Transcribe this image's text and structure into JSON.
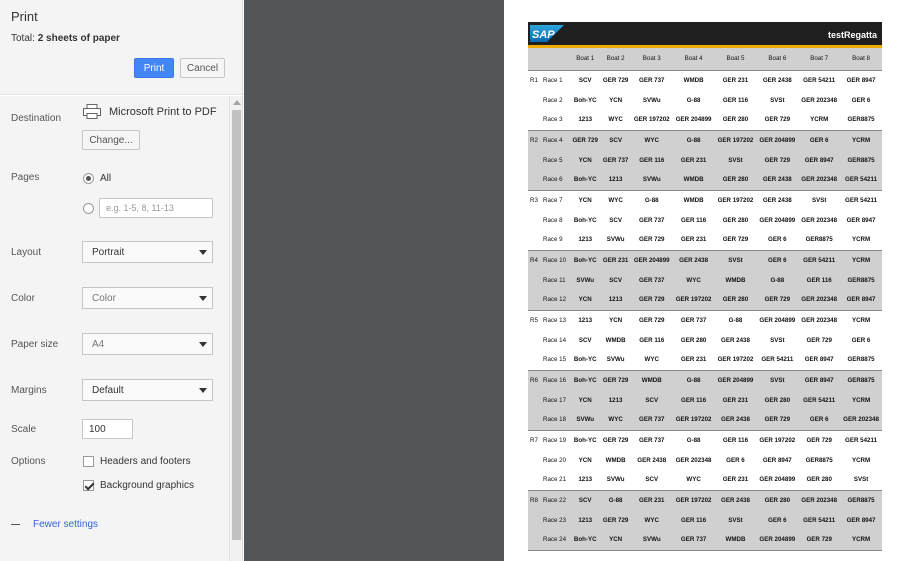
{
  "panel": {
    "title": "Print",
    "total_prefix": "Total: ",
    "total_value": "2 sheets of paper",
    "print_label": "Print",
    "cancel_label": "Cancel"
  },
  "settings": {
    "destination": {
      "label": "Destination",
      "printer": "Microsoft Print to PDF",
      "change_label": "Change..."
    },
    "pages": {
      "label": "Pages",
      "all_label": "All",
      "custom_placeholder": "e.g. 1-5, 8, 11-13"
    },
    "layout": {
      "label": "Layout",
      "value": "Portrait"
    },
    "color": {
      "label": "Color",
      "value": "Color"
    },
    "paper_size": {
      "label": "Paper size",
      "value": "A4"
    },
    "margins": {
      "label": "Margins",
      "value": "Default"
    },
    "scale": {
      "label": "Scale",
      "value": "100"
    },
    "options": {
      "label": "Options",
      "headers_footers": "Headers and footers",
      "background_graphics": "Background graphics",
      "headers_checked": false,
      "background_checked": true
    },
    "fewer_settings": "Fewer settings"
  },
  "preview": {
    "logo_text": "SAP",
    "title": "testRegatta",
    "columns": [
      "",
      "",
      "Boat 1",
      "Boat 2",
      "Boat 3",
      "Boat 4",
      "Boat 5",
      "Boat 6",
      "Boat 7",
      "Boat 8"
    ],
    "rows": [
      {
        "round": "R1",
        "race": "Race 1",
        "boats": [
          "SCV",
          "GER 729",
          "GER 737",
          "WMDB",
          "GER 231",
          "GER 2438",
          "GER 54211",
          "GER 8947"
        ]
      },
      {
        "round": "",
        "race": "Race 2",
        "boats": [
          "Boh-YC",
          "YCN",
          "SVWu",
          "G-88",
          "GER 116",
          "SVSt",
          "GER 202348",
          "GER 6"
        ]
      },
      {
        "round": "",
        "race": "Race 3",
        "boats": [
          "1213",
          "WYC",
          "GER 197202",
          "GER 204899",
          "GER 280",
          "GER 729",
          "YCRM",
          "GER8875"
        ]
      },
      {
        "round": "R2",
        "race": "Race 4",
        "boats": [
          "GER 729",
          "SCV",
          "WYC",
          "G-88",
          "GER 197202",
          "GER 204899",
          "GER 6",
          "YCRM"
        ]
      },
      {
        "round": "",
        "race": "Race 5",
        "boats": [
          "YCN",
          "GER 737",
          "GER 116",
          "GER 231",
          "SVSt",
          "GER 729",
          "GER 8947",
          "GER8875"
        ]
      },
      {
        "round": "",
        "race": "Race 6",
        "boats": [
          "Boh-YC",
          "1213",
          "SVWu",
          "WMDB",
          "GER 280",
          "GER 2438",
          "GER 202348",
          "GER 54211"
        ]
      },
      {
        "round": "R3",
        "race": "Race 7",
        "boats": [
          "YCN",
          "WYC",
          "G-88",
          "WMDB",
          "GER 197202",
          "GER 2438",
          "SVSt",
          "GER 54211"
        ]
      },
      {
        "round": "",
        "race": "Race 8",
        "boats": [
          "Boh-YC",
          "SCV",
          "GER 737",
          "GER 116",
          "GER 280",
          "GER 204899",
          "GER 202348",
          "GER 8947"
        ]
      },
      {
        "round": "",
        "race": "Race 9",
        "boats": [
          "1213",
          "SVWu",
          "GER 729",
          "GER 231",
          "GER 729",
          "GER 6",
          "GER8875",
          "YCRM"
        ]
      },
      {
        "round": "R4",
        "race": "Race 10",
        "boats": [
          "Boh-YC",
          "GER 231",
          "GER 204899",
          "GER 2438",
          "SVSt",
          "GER 6",
          "GER 54211",
          "YCRM"
        ]
      },
      {
        "round": "",
        "race": "Race 11",
        "boats": [
          "SVWu",
          "SCV",
          "GER 737",
          "WYC",
          "WMDB",
          "G-88",
          "GER 116",
          "GER8875"
        ]
      },
      {
        "round": "",
        "race": "Race 12",
        "boats": [
          "YCN",
          "1213",
          "GER 729",
          "GER 197202",
          "GER 280",
          "GER 729",
          "GER 202348",
          "GER 8947"
        ]
      },
      {
        "round": "R5",
        "race": "Race 13",
        "boats": [
          "1213",
          "YCN",
          "GER 729",
          "GER 737",
          "G-88",
          "GER 204899",
          "GER 202348",
          "YCRM"
        ]
      },
      {
        "round": "",
        "race": "Race 14",
        "boats": [
          "SCV",
          "WMDB",
          "GER 116",
          "GER 280",
          "GER 2438",
          "SVSt",
          "GER 729",
          "GER 6"
        ]
      },
      {
        "round": "",
        "race": "Race 15",
        "boats": [
          "Boh-YC",
          "SVWu",
          "WYC",
          "GER 231",
          "GER 197202",
          "GER 54211",
          "GER 8947",
          "GER8875"
        ]
      },
      {
        "round": "R6",
        "race": "Race 16",
        "boats": [
          "Boh-YC",
          "GER 729",
          "WMDB",
          "G-88",
          "GER 204899",
          "SVSt",
          "GER 8947",
          "GER8875"
        ]
      },
      {
        "round": "",
        "race": "Race 17",
        "boats": [
          "YCN",
          "1213",
          "SCV",
          "GER 116",
          "GER 231",
          "GER 280",
          "GER 54211",
          "YCRM"
        ]
      },
      {
        "round": "",
        "race": "Race 18",
        "boats": [
          "SVWu",
          "WYC",
          "GER 737",
          "GER 197202",
          "GER 2438",
          "GER 729",
          "GER 6",
          "GER 202348"
        ]
      },
      {
        "round": "R7",
        "race": "Race 19",
        "boats": [
          "Boh-YC",
          "GER 729",
          "GER 737",
          "G-88",
          "GER 116",
          "GER 197202",
          "GER 729",
          "GER 54211"
        ]
      },
      {
        "round": "",
        "race": "Race 20",
        "boats": [
          "YCN",
          "WMDB",
          "GER 2438",
          "GER 202348",
          "GER 6",
          "GER 8947",
          "GER8875",
          "YCRM"
        ]
      },
      {
        "round": "",
        "race": "Race 21",
        "boats": [
          "1213",
          "SVWu",
          "SCV",
          "WYC",
          "GER 231",
          "GER 204899",
          "GER 280",
          "SVSt"
        ]
      },
      {
        "round": "R8",
        "race": "Race 22",
        "boats": [
          "SCV",
          "G-88",
          "GER 231",
          "GER 197202",
          "GER 2438",
          "GER 280",
          "GER 202348",
          "GER8875"
        ]
      },
      {
        "round": "",
        "race": "Race 23",
        "boats": [
          "1213",
          "GER 729",
          "WYC",
          "GER 116",
          "SVSt",
          "GER 6",
          "GER 54211",
          "GER 8947"
        ]
      },
      {
        "round": "",
        "race": "Race 24",
        "boats": [
          "Boh-YC",
          "YCN",
          "SVWu",
          "GER 737",
          "WMDB",
          "GER 204899",
          "GER 729",
          "YCRM"
        ]
      }
    ]
  }
}
